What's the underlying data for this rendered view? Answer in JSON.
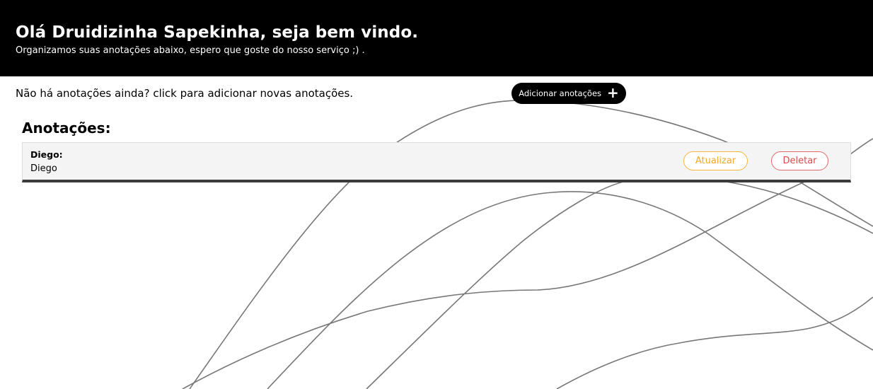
{
  "header": {
    "greeting": "Olá Druidizinha Sapekinha, seja bem vindo.",
    "subtitle": "Organizamos suas anotações abaixo, espero que goste do nosso serviço ;) ."
  },
  "toolbar": {
    "empty_message": "Não há anotações ainda? click para adicionar novas anotações.",
    "add_label": "Adicionar anotações",
    "add_icon": "+"
  },
  "notes_section": {
    "title": "Anotações:",
    "items": [
      {
        "title": "Diego:",
        "body": "Diego",
        "update_label": "Atualizar",
        "delete_label": "Deletar"
      }
    ]
  },
  "colors": {
    "header_bg": "#000000",
    "update_accent": "#f0a830",
    "delete_accent": "#d94a4a",
    "background_lines": "#777777"
  }
}
